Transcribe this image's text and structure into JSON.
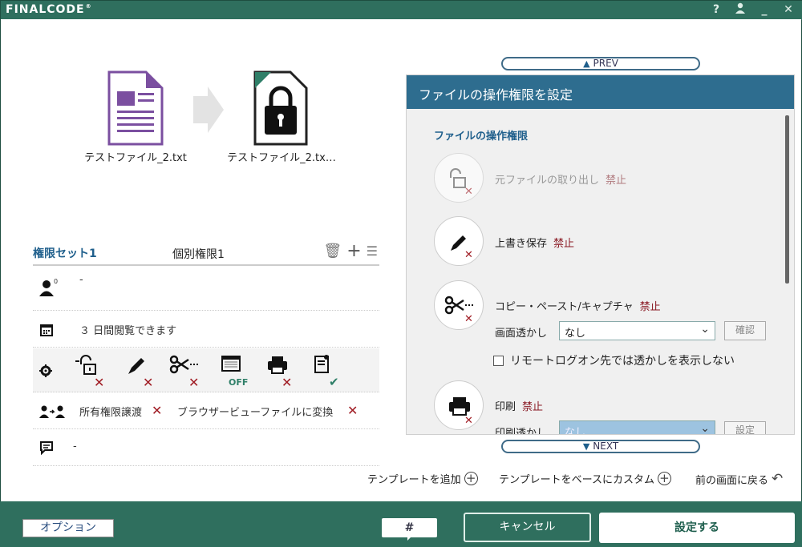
{
  "app": {
    "logo": "FINALCODE",
    "reg": "®",
    "icons": [
      "help-icon",
      "user-icon",
      "minimize-icon",
      "close-icon"
    ]
  },
  "files": {
    "source": "テストファイル_2.txt",
    "dest": "テストファイル_2.tx…"
  },
  "set": {
    "tab1": "権限セット1",
    "tab2": "個別権限1",
    "owner_count": "0",
    "owner_value": "-",
    "period": "３ 日間閲覧できます",
    "off_label": "OFF",
    "transfer": "所有権限譲渡",
    "convert": "ブラウザービューファイルに変換",
    "comment": "-"
  },
  "links": {
    "add_template": "テンプレートを追加",
    "custom_template": "テンプレートをベースにカスタム",
    "back": "前の画面に戻る"
  },
  "right": {
    "prev": "PREV",
    "next": "NEXT",
    "title": "ファイルの操作権限を設定",
    "subtitle": "ファイルの操作権限",
    "perms": [
      {
        "label": "元ファイルの取り出し",
        "status": "禁止"
      },
      {
        "label": "上書き保存",
        "status": "禁止"
      },
      {
        "label": "コピー・ペースト/キャプチャ",
        "status": "禁止"
      },
      {
        "label": "印刷",
        "status": "禁止"
      }
    ],
    "watermark_label": "画面透かし",
    "watermark_value": "なし",
    "confirm": "確認",
    "remote_label": "リモートログオン先では透かしを表示しない",
    "print_watermark_label": "印刷透かし",
    "print_watermark_value": "なし",
    "setting": "設定"
  },
  "bottom": {
    "option": "オプション",
    "hash": "#",
    "cancel": "キャンセル",
    "ok": "設定する"
  },
  "colors": {
    "brand": "#2f6f5e",
    "header": "#2e6d8f",
    "forbid": "#8a1a24"
  }
}
